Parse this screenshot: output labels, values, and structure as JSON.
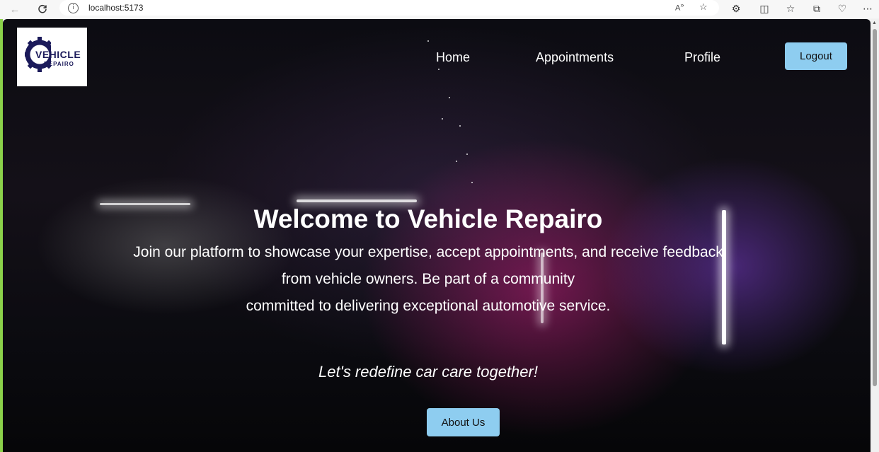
{
  "browser": {
    "url": "localhost:5173",
    "back_icon": "back-arrow-icon",
    "reload_icon": "reload-icon",
    "info_icon": "site-info-icon"
  },
  "site": {
    "logo_line1": "VEHICLE",
    "logo_line2": "REPAIRO"
  },
  "nav": {
    "home": "Home",
    "appointments": "Appointments",
    "profile": "Profile",
    "logout": "Logout"
  },
  "hero": {
    "title": "Welcome to Vehicle Repairo",
    "line1": "Join our platform to showcase your expertise, accept appointments, and receive feedback",
    "line2": "from vehicle owners. Be part of a community",
    "line3": "committed to delivering exceptional automotive service.",
    "tagline": "Let's redefine car care together!",
    "cta": "About Us"
  },
  "colors": {
    "button": "#8ecdf0",
    "logo_navy": "#1b1a5a",
    "accent_green": "#8bd14a"
  }
}
